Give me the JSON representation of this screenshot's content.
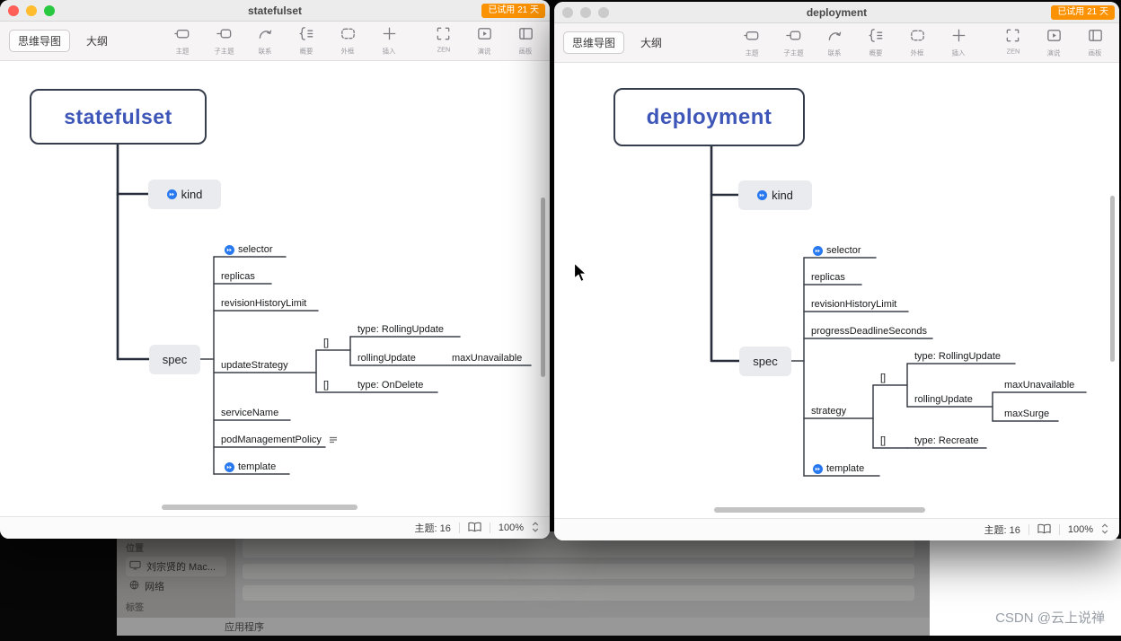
{
  "badge": "已试用 21 天",
  "toolbar": {
    "tab_mindmap": "思维导图",
    "tab_outline": "大纲",
    "items": [
      {
        "label": "主题",
        "icon": "topic-icon"
      },
      {
        "label": "子主题",
        "icon": "subtopic-icon"
      },
      {
        "label": "联系",
        "icon": "relationship-icon"
      },
      {
        "label": "概要",
        "icon": "summary-icon"
      },
      {
        "label": "外框",
        "icon": "boundary-icon"
      },
      {
        "label": "插入",
        "icon": "insert-icon"
      },
      {
        "label": "ZEN",
        "icon": "zen-icon"
      },
      {
        "label": "演说",
        "icon": "pitch-icon"
      },
      {
        "label": "画板",
        "icon": "board-icon"
      }
    ]
  },
  "statusbar": {
    "topics": "主题: 16",
    "zoom": "100%"
  },
  "left_window": {
    "title": "statefulset",
    "map": {
      "root": "statefulset",
      "kind": "kind",
      "spec": "spec",
      "selector": "selector",
      "replicas": "replicas",
      "revisionHistoryLimit": "revisionHistoryLimit",
      "updateStrategy": "updateStrategy",
      "serviceName": "serviceName",
      "podManagementPolicy": "podManagementPolicy",
      "template": "template",
      "bracket1": "[]",
      "bracket2": "[]",
      "typeRollingUpdate": "type: RollingUpdate",
      "rollingUpdate": "rollingUpdate",
      "maxUnavailable": "maxUnavailable",
      "typeOnDelete": "type: OnDelete"
    }
  },
  "right_window": {
    "title": "deployment",
    "map": {
      "root": "deployment",
      "kind": "kind",
      "spec": "spec",
      "selector": "selector",
      "replicas": "replicas",
      "revisionHistoryLimit": "revisionHistoryLimit",
      "progressDeadlineSeconds": "progressDeadlineSeconds",
      "strategy": "strategy",
      "template": "template",
      "bracket1": "[]",
      "bracket2": "[]",
      "typeRollingUpdate": "type: RollingUpdate",
      "rollingUpdate": "rollingUpdate",
      "maxUnavailable": "maxUnavailable",
      "maxSurge": "maxSurge",
      "typeRecreate": "type: Recreate"
    }
  },
  "background": {
    "sidebar": {
      "section_location": "位置",
      "item_mac": "刘宗贤的 Mac...",
      "item_network": "网络",
      "section_tags": "标签"
    },
    "bottom_item": "应用程序"
  },
  "watermark": "CSDN @云上说禅",
  "colors": {
    "badge": "#fb9203",
    "root_text": "#3d56b8",
    "marker_blue": "#2878f0",
    "traffic_red": "#ff5f57",
    "traffic_yellow": "#febc2e",
    "traffic_green": "#28c840"
  }
}
